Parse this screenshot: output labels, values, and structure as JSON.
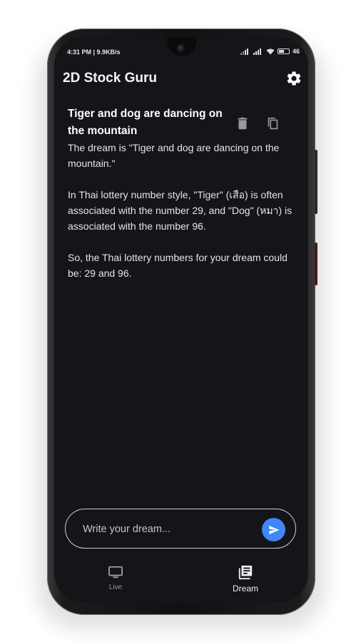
{
  "status_bar": {
    "time": "4:31 PM | 9.9KB/s",
    "battery": "46"
  },
  "app_bar": {
    "title": "2D Stock Guru"
  },
  "dream_card": {
    "title": "Tiger and dog are dancing on the mountain",
    "paragraphs": [
      "The dream is \"Tiger and dog are dancing on the mountain.\"",
      "In Thai lottery number style, \"Tiger\" (เสือ) is often associated with the number 29, and \"Dog\" (หมา) is associated with the number 96.",
      "So, the Thai lottery numbers for your dream could be: 29 and 96."
    ]
  },
  "composer": {
    "placeholder": "Write your dream..."
  },
  "bottom_nav": {
    "items": [
      {
        "label": "Live",
        "icon": "tv-icon",
        "active": false
      },
      {
        "label": "Dream",
        "icon": "news-icon",
        "active": true
      }
    ]
  },
  "colors": {
    "screen_bg": "#141419",
    "accent": "#3f87f5"
  }
}
